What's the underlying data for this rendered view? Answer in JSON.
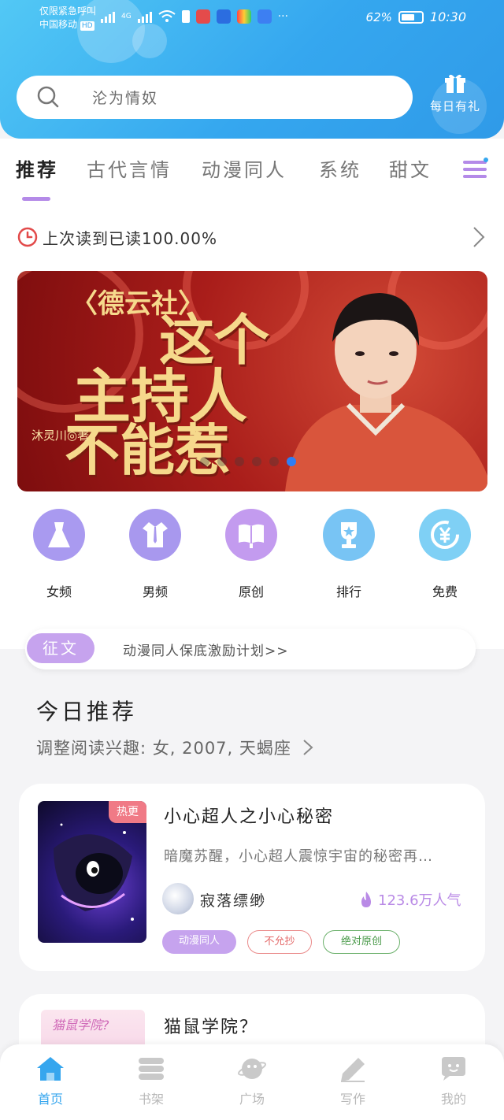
{
  "status_bar": {
    "carrier_line1": "仅限紧急呼叫",
    "carrier_line2": "中国移动",
    "hd": "HD",
    "network": "4G",
    "more": "···",
    "battery_percent": "62%",
    "time": "10:30"
  },
  "header": {
    "search_placeholder": "沦为情奴",
    "gift_label": "每日有礼"
  },
  "tabs": [
    {
      "label": "推荐",
      "active": true
    },
    {
      "label": "古代言情"
    },
    {
      "label": "动漫同人"
    },
    {
      "label": "系统"
    },
    {
      "label": "甜文"
    }
  ],
  "last_read": "上次读到已读100.00%",
  "banner": {
    "series": "〈德云社〉",
    "title_line1": "这个",
    "title_line2": "主持人",
    "title_line3": "不能惹",
    "author": "沐灵川◎著",
    "slide_count": 6,
    "active_slide": 6
  },
  "categories": [
    {
      "label": "女频",
      "icon": "dress-icon",
      "color": "#a99af0"
    },
    {
      "label": "男频",
      "icon": "shirt-icon",
      "color": "#a898ee"
    },
    {
      "label": "原创",
      "icon": "book-icon",
      "color": "#c39bef"
    },
    {
      "label": "排行",
      "icon": "trophy-icon",
      "color": "#78c4f4"
    },
    {
      "label": "免费",
      "icon": "yen-coin-icon",
      "color": "#7fd0f5"
    }
  ],
  "notice": {
    "badge": "征文",
    "text": "动漫同人保底激励计划>>"
  },
  "today": {
    "title": "今日推荐",
    "subtitle": "调整阅读兴趣: 女, 2007, 天蝎座"
  },
  "books": [
    {
      "badge": "热更",
      "title": "小心超人之小心秘密",
      "description": "暗魔苏醒，小心超人震惊宇宙的秘密再…",
      "author": "寂落缥缈",
      "popularity": "123.6万人气",
      "tags": [
        "动漫同人",
        "不允抄",
        "绝对原创"
      ]
    },
    {
      "title": "猫鼠学院？",
      "cover_text": "猫鼠学院?"
    }
  ],
  "bottom_nav": [
    {
      "label": "首页",
      "icon": "home-icon",
      "active": true
    },
    {
      "label": "书架",
      "icon": "bookshelf-icon"
    },
    {
      "label": "广场",
      "icon": "planet-icon"
    },
    {
      "label": "写作",
      "icon": "pen-icon"
    },
    {
      "label": "我的",
      "icon": "chat-face-icon"
    }
  ],
  "colors": {
    "header_blue": "#35a7ef",
    "accent_purple": "#b48ae8",
    "active_dot": "#2f7ef5"
  }
}
